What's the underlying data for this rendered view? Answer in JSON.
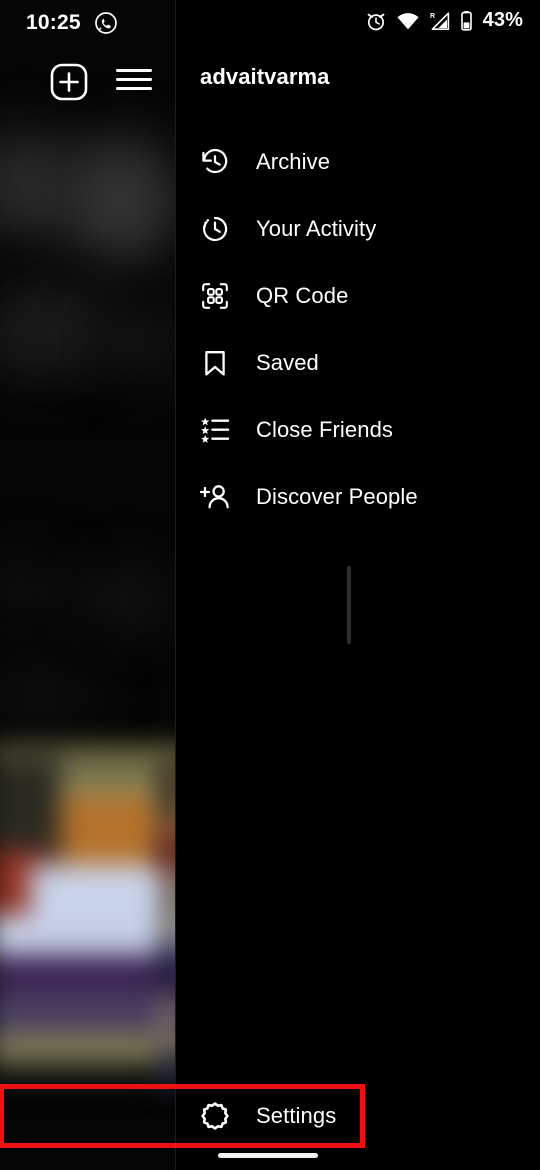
{
  "status_bar": {
    "time": "10:25",
    "whatsapp_icon": "whatsapp-icon",
    "alarm_icon": "alarm-clock-icon",
    "wifi_icon": "wifi-icon",
    "signal_icon": "cellular-signal-icon",
    "roaming_label": "R",
    "battery_icon": "battery-icon",
    "battery_percent": "43%"
  },
  "top_bar": {
    "add_post_icon": "add-post-icon",
    "menu_icon": "hamburger-menu-icon"
  },
  "drawer": {
    "username": "advaitvarma",
    "items": [
      {
        "label": "Archive",
        "icon": "archive-clock-icon"
      },
      {
        "label": "Your Activity",
        "icon": "activity-clock-icon"
      },
      {
        "label": "QR Code",
        "icon": "qr-code-icon"
      },
      {
        "label": "Saved",
        "icon": "bookmark-icon"
      },
      {
        "label": "Close Friends",
        "icon": "star-list-icon"
      },
      {
        "label": "Discover People",
        "icon": "person-add-icon"
      }
    ],
    "settings": {
      "label": "Settings",
      "icon": "gear-icon"
    }
  },
  "highlight": {
    "color": "#ee1111",
    "target": "Settings"
  },
  "colors": {
    "background": "#000000",
    "text": "#ffffff",
    "divider": "#1d1d1d",
    "accent_red": "#ee1111"
  },
  "system": {
    "home_indicator": "home-indicator"
  }
}
